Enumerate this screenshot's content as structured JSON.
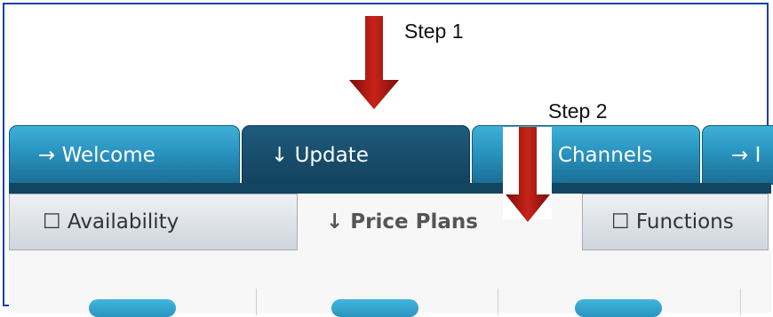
{
  "annotations": {
    "step1_label": "Step 1",
    "step2_label": "Step 2",
    "arrow_color": "#b01810"
  },
  "top_tabs": [
    {
      "label": "→ Welcome",
      "state": "inactive"
    },
    {
      "label": "↓ Update",
      "state": "active"
    },
    {
      "label": "y Channels",
      "state": "inactive"
    },
    {
      "label": "→ I",
      "state": "inactive"
    }
  ],
  "sub_tabs": [
    {
      "label": "☐ Availability",
      "state": "inactive"
    },
    {
      "label": "↓ Price Plans",
      "state": "active"
    },
    {
      "label": "☐ Functions",
      "state": "inactive"
    }
  ],
  "colors": {
    "frame_border": "#1f3fa6",
    "tab_blue": "#2b97c3",
    "tab_dark": "#13425d"
  }
}
